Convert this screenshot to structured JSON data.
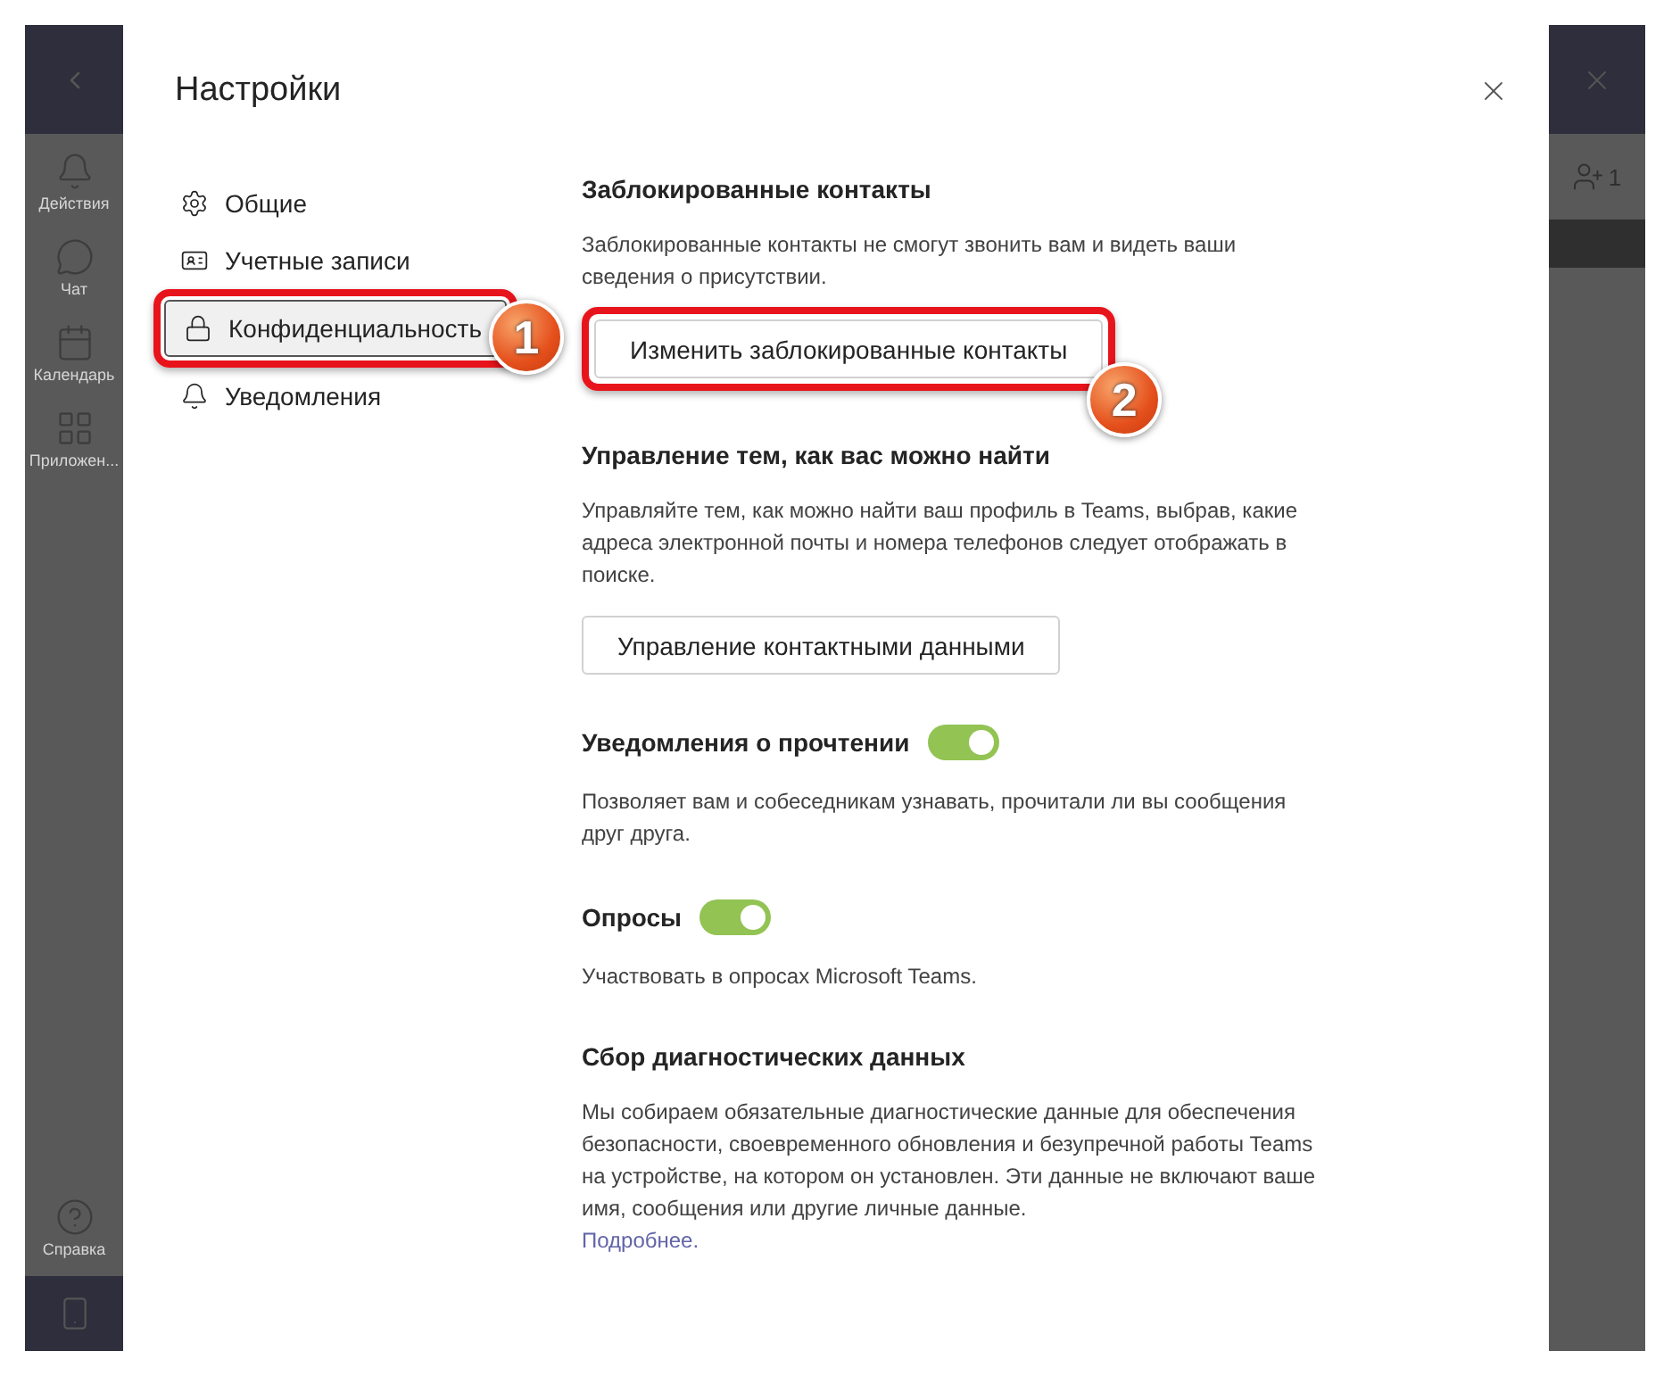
{
  "app_rail": {
    "items": [
      {
        "kind": "bell",
        "label": "Действия"
      },
      {
        "kind": "chat",
        "label": "Чат"
      },
      {
        "kind": "calendar",
        "label": "Календарь"
      },
      {
        "kind": "apps",
        "label": "Приложен..."
      }
    ],
    "help_label": "Справка"
  },
  "people_count": "1",
  "dialog": {
    "title": "Настройки",
    "nav": [
      {
        "kind": "gear",
        "label": "Общие",
        "selected": false
      },
      {
        "kind": "card",
        "label": "Учетные записи",
        "selected": false
      },
      {
        "kind": "lock",
        "label": "Конфиденциальность",
        "selected": true,
        "callout": "1"
      },
      {
        "kind": "bell",
        "label": "Уведомления",
        "selected": false
      }
    ],
    "sections": [
      {
        "kind": "button",
        "heading": "Заблокированные контакты",
        "description": "Заблокированные контакты не смогут звонить вам и видеть ваши сведения о присутствии.",
        "button": {
          "label": "Изменить заблокированные контакты",
          "callout": "2"
        }
      },
      {
        "kind": "button",
        "heading": "Управление тем, как вас можно найти",
        "description": "Управляйте тем, как можно найти ваш профиль в Teams, выбрав, какие адреса электронной почты и номера телефонов следует отображать в поиске.",
        "button": {
          "label": "Управление контактными данными"
        }
      },
      {
        "kind": "toggle",
        "heading": "Уведомления о прочтении",
        "on": true,
        "description": "Позволяет вам и собеседникам узнавать, прочитали ли вы сообщения друг друга."
      },
      {
        "kind": "toggle",
        "heading": "Опросы",
        "on": true,
        "description": "Участвовать в опросах Microsoft Teams."
      },
      {
        "kind": "link",
        "heading": "Сбор диагностических данных",
        "description": "Мы собираем обязательные диагностические данные для обеспечения безопасности, своевременного обновления и безупречной работы Teams на устройстве, на котором он установлен. Эти данные не включают ваше имя, сообщения или другие личные данные.",
        "link": "Подробнее."
      }
    ]
  }
}
